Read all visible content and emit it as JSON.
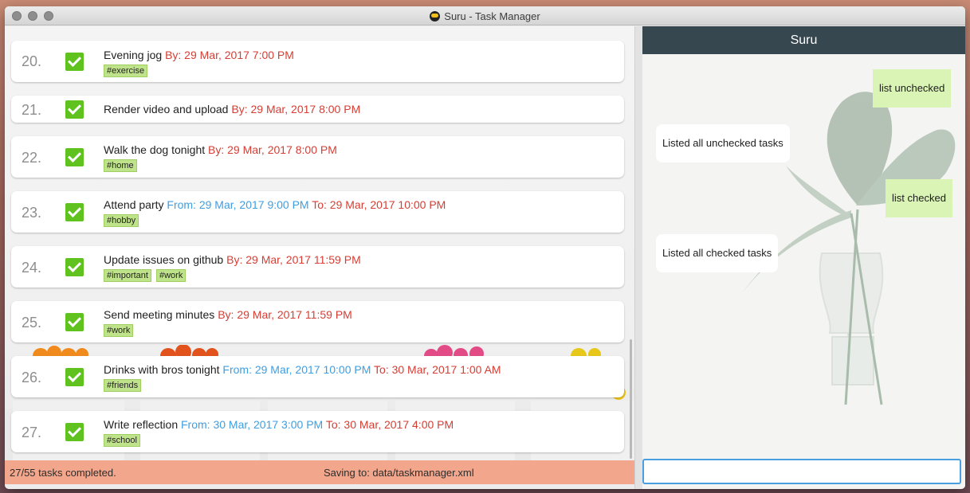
{
  "window": {
    "title": "Suru - Task Manager"
  },
  "tasks": [
    {
      "index": "20.",
      "name": "Evening jog",
      "by": "By: 29 Mar, 2017 7:00 PM",
      "tags": [
        "#exercise"
      ]
    },
    {
      "index": "21.",
      "name": "Render video and upload",
      "by": "By: 29 Mar, 2017 8:00 PM",
      "tags": []
    },
    {
      "index": "22.",
      "name": "Walk the dog tonight",
      "by": "By: 29 Mar, 2017 8:00 PM",
      "tags": [
        "#home"
      ]
    },
    {
      "index": "23.",
      "name": "Attend party",
      "from": "From: 29 Mar, 2017 9:00 PM",
      "to": "To: 29 Mar, 2017 10:00 PM",
      "tags": [
        "#hobby"
      ]
    },
    {
      "index": "24.",
      "name": "Update issues on github",
      "by": "By: 29 Mar, 2017 11:59 PM",
      "tags": [
        "#important",
        "#work"
      ]
    },
    {
      "index": "25.",
      "name": "Send meeting minutes",
      "by": "By: 29 Mar, 2017 11:59 PM",
      "tags": [
        "#work"
      ]
    },
    {
      "index": "26.",
      "name": "Drinks with bros tonight",
      "from": "From: 29 Mar, 2017 10:00 PM",
      "to": "To: 30 Mar, 2017 1:00 AM",
      "tags": [
        "#friends"
      ]
    },
    {
      "index": "27.",
      "name": "Write reflection",
      "from": "From: 30 Mar, 2017 3:00 PM",
      "to": "To: 30 Mar, 2017 4:00 PM",
      "tags": [
        "#school"
      ]
    }
  ],
  "status_bar": {
    "completed": "27/55 tasks completed.",
    "saving": "Saving to: data/taskmanager.xml"
  },
  "chat": {
    "header": "Suru",
    "messages": [
      {
        "role": "user",
        "text": "list unchecked"
      },
      {
        "role": "bot",
        "text": "Listed all unchecked tasks"
      },
      {
        "role": "user",
        "text": "list checked"
      },
      {
        "role": "bot",
        "text": "Listed all checked tasks"
      }
    ],
    "input_value": ""
  },
  "colors": {
    "check": "#60c21f",
    "deadline": "#d63d33",
    "start": "#3f9ee0",
    "tag_bg": "#bfe38a",
    "status_bar": "#f2a78d",
    "chat_header": "#37474f",
    "user_bubble": "#d9f4b4",
    "input_focus": "#4a9fe0"
  },
  "icons": {
    "task_done": "checkbox-checked-icon",
    "app": "suru-app-icon"
  }
}
